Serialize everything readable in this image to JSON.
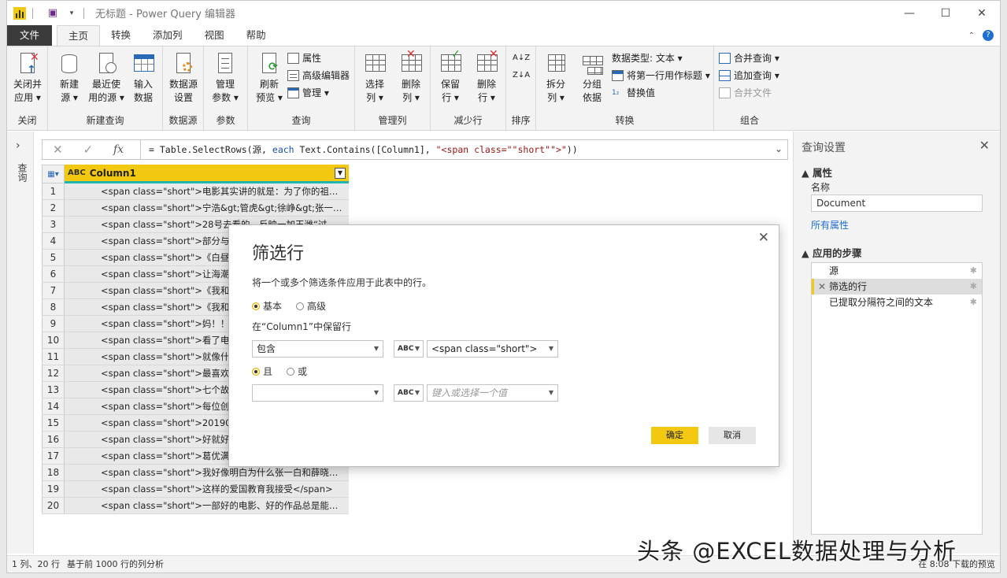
{
  "titlebar": {
    "title": "无标题 - Power Query 编辑器",
    "minimize": "—",
    "maximize": "☐",
    "close": "✕"
  },
  "tabs": [
    {
      "label": "文件"
    },
    {
      "label": "主页"
    },
    {
      "label": "转换"
    },
    {
      "label": "添加列"
    },
    {
      "label": "视图"
    },
    {
      "label": "帮助"
    }
  ],
  "ribbon": {
    "close_apply": "关闭并\n应用 ▾",
    "new_source": "新建\n源 ▾",
    "recent_sources": "最近使\n用的源 ▾",
    "enter_data": "输入\n数据",
    "ds_settings": "数据源\n设置",
    "manage_params": "管理\n参数 ▾",
    "refresh_preview": "刷新\n预览 ▾",
    "properties": "属性",
    "advanced_editor": "高级编辑器",
    "manage": "管理 ▾",
    "choose_cols": "选择\n列 ▾",
    "remove_cols": "删除\n列 ▾",
    "keep_rows": "保留\n行 ▾",
    "remove_rows": "删除\n行 ▾",
    "split_col": "拆分\n列 ▾",
    "group_by": "分组\n依据",
    "data_type": "数据类型: 文本 ▾",
    "first_row_header": "将第一行用作标题 ▾",
    "replace_values": "替换值",
    "merge_queries": "合并查询 ▾",
    "append_queries": "追加查询 ▾",
    "combine_files": "合并文件",
    "groups": {
      "close": "关闭",
      "new_query": "新建查询",
      "data_sources": "数据源",
      "parameters": "参数",
      "query": "查询",
      "manage_cols": "管理列",
      "reduce_rows": "减少行",
      "sort": "排序",
      "transform": "转换",
      "combine": "组合"
    }
  },
  "left_pane": {
    "label": "查询"
  },
  "formula": {
    "cancel": "✕",
    "commit": "✓",
    "fx": "fx",
    "p1": "= Table.SelectRows(源, ",
    "kw": "each",
    "p2": " Text.Contains([Column1], ",
    "str": "\"<span class=\"\"short\"\">\"",
    "p3": "))"
  },
  "grid": {
    "column": "Column1",
    "type_label": "ABC",
    "rows": [
      {
        "n": "1",
        "v": "<span class=\"short\">电影其实讲的就是：为了你的祖国，…"
      },
      {
        "n": "2",
        "v": "<span class=\"short\">宁浩&gt;管虎&gt;徐峥&gt;张一白&gt;…"
      },
      {
        "n": "3",
        "v": "<span class=\"short\">28号去看的，反映一加王潍“过的，五班…"
      },
      {
        "n": "4",
        "v": "<span class=\"short\">部分与部分"
      },
      {
        "n": "5",
        "v": "<span class=\"short\">《白昼流星"
      },
      {
        "n": "6",
        "v": "<span class=\"short\">让海潮伴我"
      },
      {
        "n": "7",
        "v": "<span class=\"short\">《我和我的"
      },
      {
        "n": "8",
        "v": "<span class=\"short\">《我和我的"
      },
      {
        "n": "9",
        "v": "<span class=\"short\">妈！！！！"
      },
      {
        "n": "10",
        "v": "<span class=\"short\">看了电影，"
      },
      {
        "n": "11",
        "v": "<span class=\"short\">就像什么呢"
      },
      {
        "n": "12",
        "v": "<span class=\"short\">最喜欢的是"
      },
      {
        "n": "13",
        "v": "<span class=\"short\">七个故事，"
      },
      {
        "n": "14",
        "v": "<span class=\"short\">每位创作者"
      },
      {
        "n": "15",
        "v": "<span class=\"short\">20190719想"
      },
      {
        "n": "16",
        "v": "<span class=\"short\">好就好在，"
      },
      {
        "n": "17",
        "v": "<span class=\"short\">葛优满分</"
      },
      {
        "n": "18",
        "v": "<span class=\"short\">我好像明白为什么张一白和薛晓路能…"
      },
      {
        "n": "19",
        "v": "<span class=\"short\">这样的爱国教育我接受</span>"
      },
      {
        "n": "20",
        "v": "<span class=\"short\">一部好的电影、好的作品总是能激起…"
      }
    ]
  },
  "query_settings": {
    "title": "查询设置",
    "properties_header": "▲ 属性",
    "name_label": "名称",
    "name_value": "Document",
    "all_properties": "所有属性",
    "steps_header": "▲ 应用的步骤",
    "steps": [
      {
        "label": "源"
      },
      {
        "label": "筛选的行"
      },
      {
        "label": "已提取分隔符之间的文本"
      }
    ]
  },
  "status": {
    "left": "1 列、20 行",
    "mid": "基于前 1000 行的列分析",
    "right": "在 8:08 下载的预览"
  },
  "watermark": "头条 @EXCEL数据处理与分析",
  "dialog": {
    "title": "筛选行",
    "desc": "将一个或多个筛选条件应用于此表中的行。",
    "basic": "基本",
    "advanced": "高级",
    "keep_label": "在“Column1”中保留行",
    "operator1": "包含",
    "value1": "<span class=\"short\">",
    "and": "且",
    "or": "或",
    "operator2": "",
    "value2_placeholder": "键入或选择一个值",
    "type_label": "ABC",
    "ok": "确定",
    "cancel": "取消"
  },
  "colors": {
    "accent": "#f2c811",
    "teal": "#1fb5b0",
    "link": "#1e6fd0"
  }
}
